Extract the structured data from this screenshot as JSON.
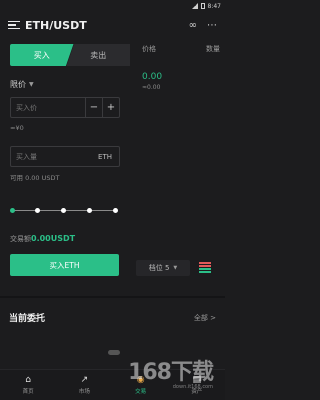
{
  "status": {
    "time": "8:47"
  },
  "header": {
    "pair": "ETH/USDT",
    "icons": [
      "menu-icon",
      "link-icon",
      "more-icon"
    ]
  },
  "tabs": {
    "buy": "买入",
    "sell": "卖出"
  },
  "order_type": {
    "label": "限价"
  },
  "price_input": {
    "placeholder": "买入价",
    "minus": "−",
    "plus": "+"
  },
  "approx_value": "≈¥0",
  "amount_input": {
    "placeholder": "买入量",
    "unit": "ETH"
  },
  "available": "可用 0.00 USDT",
  "slider": {
    "value_fraction": 0
  },
  "total": {
    "label": "交易额",
    "value": "0.00USDT"
  },
  "buy_button": "买入ETH",
  "book": {
    "price_header": "价格",
    "amount_header": "数量",
    "last_price": "0.00",
    "last_price_cny": "≈0.00"
  },
  "depth": {
    "label": "档位 5"
  },
  "orders": {
    "title": "当前委托",
    "all": "全部 >"
  },
  "nav": [
    {
      "label": "首页",
      "icon": "home-icon"
    },
    {
      "label": "市场",
      "icon": "market-icon"
    },
    {
      "label": "交易",
      "icon": "trade-icon"
    },
    {
      "label": "资产",
      "icon": "assets-icon"
    }
  ],
  "watermark": {
    "big": "168下载",
    "small": "down.it168.com"
  },
  "colors": {
    "accent": "#2bbf88",
    "bg": "#1c1c1e"
  }
}
